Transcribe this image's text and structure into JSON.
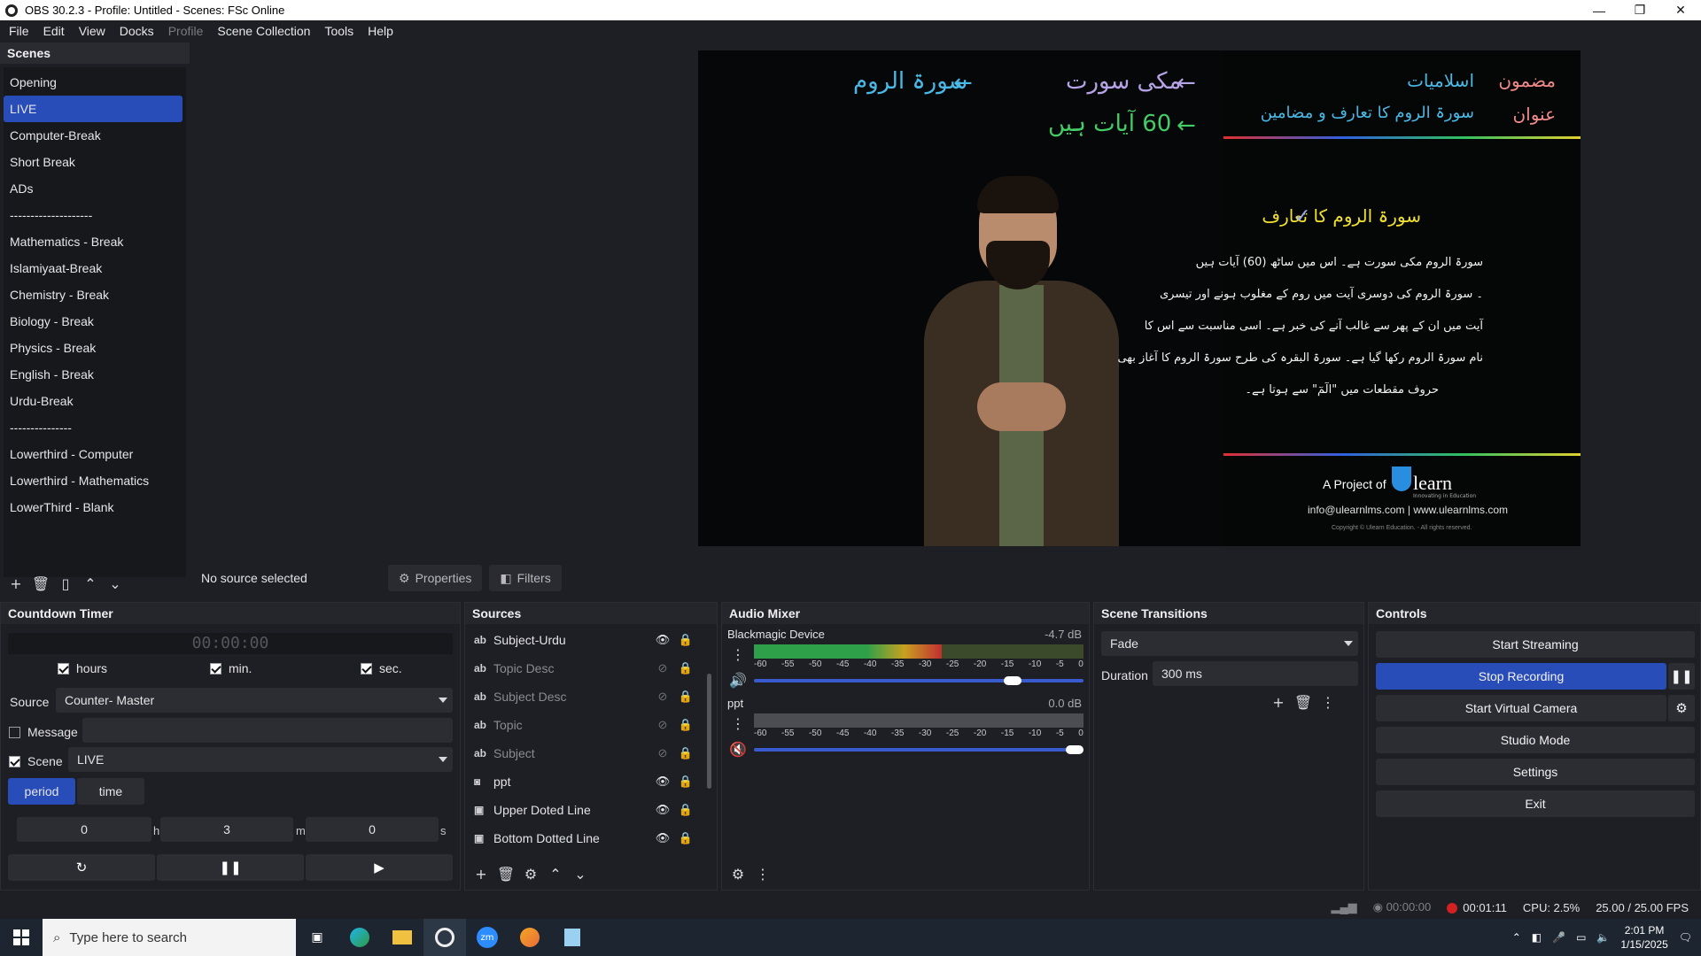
{
  "window": {
    "title": "OBS 30.2.3 - Profile: Untitled - Scenes: FSc Online"
  },
  "menu": [
    "File",
    "Edit",
    "View",
    "Docks",
    "Profile",
    "Scene Collection",
    "Tools",
    "Help"
  ],
  "scenes": {
    "title": "Scenes",
    "items": [
      "Opening",
      "LIVE",
      "Computer-Break",
      "Short Break",
      "ADs",
      "--------------------",
      "Mathematics  - Break",
      "Islamiyaat-Break",
      "Chemistry  - Break",
      "Biology  - Break",
      "Physics  - Break",
      "English - Break",
      "Urdu-Break",
      "---------------",
      "Lowerthird - Computer",
      "Lowerthird - Mathematics",
      "LowerThird - Blank"
    ],
    "selected": "LIVE"
  },
  "preview": {
    "left_line1": "سورۃ الروم ← مکی سورت ←",
    "left_line1_a": "سورۃ الروم",
    "left_line1_b": "مکی سورت",
    "left_line2": "60 آیات ہیں",
    "subject_label": "مضمون",
    "subject_value": "اسلامیات",
    "topic_label": "عنوان",
    "topic_value": "سورۃ الروم کا تعارف و مضامین",
    "heading": "سورۃ الروم کا تعارف",
    "body_lines": [
      "سورۃ الروم مکی سورت ہے۔ اس میں ساٹھ (60) آیات ہیں",
      "۔ سورۃ الروم کی دوسری آیت میں روم کے مغلوب ہونے اور تیسری",
      "آیت میں ان کے پھر سے غالب آنے کی خبر ہے۔ اسی مناسبت سے اس کا",
      "نام سورۃ الروم رکھا گیا ہے۔ سورۃ البقرہ کی طرح سورۃ الروم کا آغاز بھی",
      "حروف مقطعات میں \"الٓمٓ\" سے ہوتا ہے۔"
    ],
    "project_of": "A Project of",
    "brand": "learn",
    "brand_tagline": "Innovating in Education",
    "contact": "info@ulearnlms.com | www.ulearnlms.com",
    "copyright": "Copyright © Ulearn Education. - All rights reserved."
  },
  "context": {
    "no_source": "No source selected",
    "properties": "Properties",
    "filters": "Filters"
  },
  "countdown": {
    "title": "Countdown Timer",
    "display": "00:00:00",
    "hours": "hours",
    "min": "min.",
    "sec": "sec.",
    "source_label": "Source",
    "source_value": "Counter- Master",
    "message_label": "Message",
    "scene_label": "Scene",
    "scene_value": "LIVE",
    "tab_period": "period",
    "tab_time": "time",
    "h_value": "0",
    "h_unit": "h",
    "m_value": "3",
    "m_unit": "m",
    "s_value": "0",
    "s_unit": "s"
  },
  "sources": {
    "title": "Sources",
    "items": [
      {
        "icon": "ab",
        "name": "Subject-Urdu",
        "visible": true
      },
      {
        "icon": "ab",
        "name": "Topic Desc",
        "visible": false
      },
      {
        "icon": "ab",
        "name": "Subject Desc",
        "visible": false
      },
      {
        "icon": "ab",
        "name": "Topic",
        "visible": false
      },
      {
        "icon": "ab",
        "name": "Subject",
        "visible": false
      },
      {
        "icon": "cam",
        "name": "ppt",
        "visible": true
      },
      {
        "icon": "img",
        "name": "Upper Doted Line",
        "visible": true
      },
      {
        "icon": "img",
        "name": "Bottom Dotted Line",
        "visible": true
      }
    ]
  },
  "audio": {
    "title": "Audio Mixer",
    "channels": [
      {
        "name": "Blackmagic Device",
        "db": "-4.7 dB",
        "level": 0.57,
        "muted": false,
        "volume": 0.8
      },
      {
        "name": "ppt",
        "db": "0.0 dB",
        "level": 0,
        "muted": true,
        "volume": 1.0
      }
    ],
    "scale": [
      "-60",
      "-55",
      "-50",
      "-45",
      "-40",
      "-35",
      "-30",
      "-25",
      "-20",
      "-15",
      "-10",
      "-5",
      "0"
    ]
  },
  "transitions": {
    "title": "Scene Transitions",
    "type": "Fade",
    "duration_label": "Duration",
    "duration_value": "300 ms"
  },
  "controls": {
    "title": "Controls",
    "start_streaming": "Start Streaming",
    "stop_recording": "Stop Recording",
    "start_virtual_camera": "Start Virtual Camera",
    "studio_mode": "Studio Mode",
    "settings": "Settings",
    "exit": "Exit"
  },
  "status": {
    "stream_time": "00:00:00",
    "rec_time": "00:01:11",
    "cpu": "CPU: 2.5%",
    "fps": "25.00 / 25.00 FPS"
  },
  "taskbar": {
    "search_placeholder": "Type here to search",
    "time": "2:01 PM",
    "date": "1/15/2025"
  }
}
